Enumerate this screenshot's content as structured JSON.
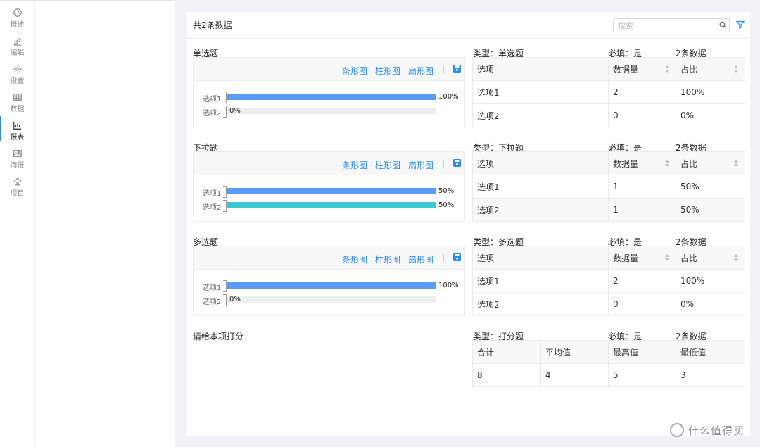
{
  "sidebar": {
    "items": [
      {
        "label": "概述",
        "icon": "gauge-icon"
      },
      {
        "label": "编辑",
        "icon": "pencil-icon"
      },
      {
        "label": "设置",
        "icon": "gear-icon"
      },
      {
        "label": "数据",
        "icon": "table-icon"
      },
      {
        "label": "报表",
        "icon": "bar-chart-icon",
        "active": true
      },
      {
        "label": "海报",
        "icon": "image-icon"
      },
      {
        "label": "项目",
        "icon": "home-icon"
      }
    ]
  },
  "header": {
    "total_label": "共2条数据",
    "search_placeholder": "搜索",
    "search_value": ""
  },
  "chart_tabs": [
    "条形图",
    "柱形图",
    "扇形图"
  ],
  "accent_color": "#2d8cf0",
  "questions": [
    {
      "title": "单选题",
      "type_label": "类型：单选题",
      "required_label": "必填：是",
      "count_label": "2条数据",
      "table_headers": [
        "选项",
        "数据量",
        "占比"
      ],
      "rows": [
        {
          "option": "选项1",
          "count": "2",
          "ratio": "100%"
        },
        {
          "option": "选项2",
          "count": "0",
          "ratio": "0%"
        }
      ]
    },
    {
      "title": "下拉题",
      "type_label": "类型：下拉题",
      "required_label": "必填：是",
      "count_label": "2条数据",
      "table_headers": [
        "选项",
        "数据量",
        "占比"
      ],
      "rows": [
        {
          "option": "选项1",
          "count": "1",
          "ratio": "50%"
        },
        {
          "option": "选项2",
          "count": "1",
          "ratio": "50%"
        }
      ]
    },
    {
      "title": "多选题",
      "type_label": "类型：多选题",
      "required_label": "必填：是",
      "count_label": "2条数据",
      "table_headers": [
        "选项",
        "数据量",
        "占比"
      ],
      "rows": [
        {
          "option": "选项1",
          "count": "2",
          "ratio": "100%"
        },
        {
          "option": "选项2",
          "count": "0",
          "ratio": "0%"
        }
      ]
    },
    {
      "title": "请给本项打分",
      "type_label": "类型：打分题",
      "required_label": "必填：是",
      "count_label": "2条数据",
      "score_headers": [
        "合计",
        "平均值",
        "最高值",
        "最低值"
      ],
      "score_values": [
        "8",
        "4",
        "5",
        "3"
      ]
    }
  ],
  "chart_data": [
    {
      "type": "bar",
      "orientation": "horizontal",
      "categories": [
        "选项1",
        "选项2"
      ],
      "values": [
        100,
        0
      ],
      "value_labels": [
        "100%",
        "0%"
      ],
      "colors": [
        "#5b9bf8",
        "#eeeeee"
      ],
      "xlim": [
        0,
        100
      ]
    },
    {
      "type": "bar",
      "orientation": "horizontal",
      "categories": [
        "选项1",
        "选项2"
      ],
      "values": [
        50,
        50
      ],
      "value_labels": [
        "50%",
        "50%"
      ],
      "colors": [
        "#5b9bf8",
        "#3cc8d0"
      ],
      "xlim": [
        0,
        50
      ]
    },
    {
      "type": "bar",
      "orientation": "horizontal",
      "categories": [
        "选项1",
        "选项2"
      ],
      "values": [
        100,
        0
      ],
      "value_labels": [
        "100%",
        "0%"
      ],
      "colors": [
        "#5b9bf8",
        "#eeeeee"
      ],
      "xlim": [
        0,
        100
      ]
    }
  ],
  "watermark": {
    "text": "什么值得买",
    "logo_glyph": "值"
  }
}
